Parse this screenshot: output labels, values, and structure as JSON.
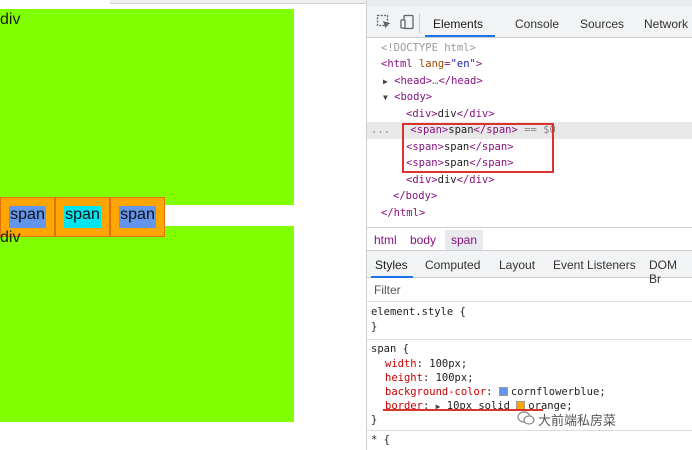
{
  "page": {
    "div1_label": "div",
    "div2_label": "div",
    "spans": [
      {
        "label": "span",
        "bg": "#6495ed"
      },
      {
        "label": "span",
        "bg": "#00e5ee"
      },
      {
        "label": "span",
        "bg": "#6495ed"
      }
    ]
  },
  "devtools": {
    "tabs": [
      "Elements",
      "Console",
      "Sources",
      "Network"
    ],
    "active_tab": "Elements",
    "dom": {
      "doctype": "<!DOCTYPE html>",
      "html_open_tag": "html",
      "html_attr_name": "lang",
      "html_attr_value": "\"en\"",
      "head_tag": "head",
      "head_ellipsis": "…",
      "body_tag": "body",
      "div_tag": "div",
      "div_text": "div",
      "span_tag": "span",
      "span_text": "span",
      "selected_marker": "== $0",
      "row_dots": "..."
    },
    "breadcrumbs": [
      "html",
      "body",
      "span"
    ],
    "subtabs": [
      "Styles",
      "Computed",
      "Layout",
      "Event Listeners",
      "DOM Br"
    ],
    "filter_placeholder": "Filter",
    "styles": {
      "element_style": "element.style {",
      "close": "}",
      "span_selector": "span {",
      "rules": [
        {
          "prop": "width",
          "value": "100px;"
        },
        {
          "prop": "height",
          "value": "100px;"
        },
        {
          "prop": "background-color",
          "value": "cornflowerblue;",
          "swatch": "#6495ed"
        },
        {
          "prop": "border",
          "value": "10px solid",
          "value2": "orange;",
          "swatch": "#ffa500"
        }
      ],
      "star_selector": "* {"
    },
    "watermark": "大前端私房菜"
  }
}
